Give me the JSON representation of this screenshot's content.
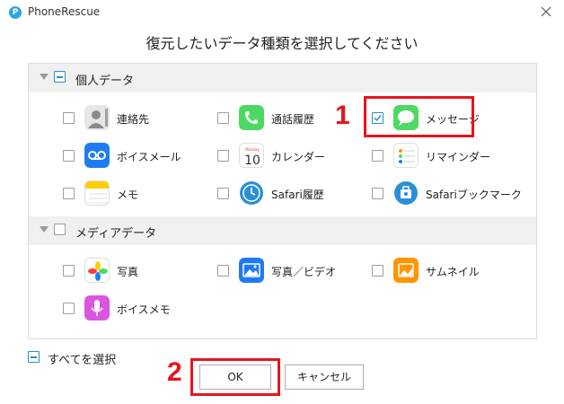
{
  "window": {
    "title": "PhoneRescue",
    "logo_glyph": "P"
  },
  "heading": "復元したいデータ種類を選択してください",
  "groups": [
    {
      "label": "個人データ",
      "items": [
        {
          "label": "連絡先",
          "icon": "contacts-icon",
          "checked": false
        },
        {
          "label": "通話履歴",
          "icon": "phone-icon",
          "checked": false
        },
        {
          "label": "メッセージ",
          "icon": "messages-icon",
          "checked": true
        },
        {
          "label": "ボイスメール",
          "icon": "voicemail-icon",
          "checked": false
        },
        {
          "label": "カレンダー",
          "icon": "calendar-icon",
          "checked": false
        },
        {
          "label": "リマインダー",
          "icon": "reminders-icon",
          "checked": false
        },
        {
          "label": "メモ",
          "icon": "notes-icon",
          "checked": false
        },
        {
          "label": "Safari履歴",
          "icon": "safari-history-icon",
          "checked": false
        },
        {
          "label": "Safariブックマーク",
          "icon": "safari-bookmark-icon",
          "checked": false
        }
      ]
    },
    {
      "label": "メディアデータ",
      "items": [
        {
          "label": "写真",
          "icon": "photos-icon",
          "checked": false
        },
        {
          "label": "写真／ビデオ",
          "icon": "photo-video-icon",
          "checked": false
        },
        {
          "label": "サムネイル",
          "icon": "thumbnail-icon",
          "checked": false
        },
        {
          "label": "ボイスメモ",
          "icon": "voice-memo-icon",
          "checked": false
        }
      ]
    }
  ],
  "calendar_icon_month": "Monday",
  "calendar_icon_day": "10",
  "select_all_label": "すべてを選択",
  "buttons": {
    "ok": "OK",
    "cancel": "キャンセル"
  },
  "annotations": {
    "step1": "1",
    "step2": "2"
  },
  "colors": {
    "accent": "#2a8fbd",
    "annotation": "#e8141c"
  }
}
